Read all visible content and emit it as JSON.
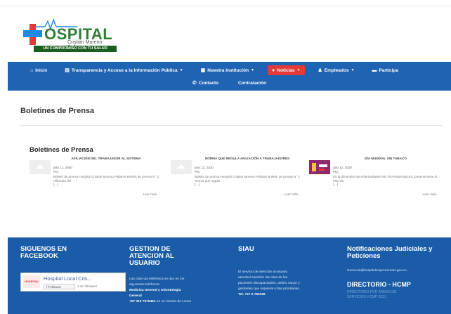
{
  "logo": {
    "brand": "OSPITAL",
    "subtitle": "Cristián Moreno Pallares",
    "tagline": "UN COMPROMISO CON TU SALUD"
  },
  "nav": {
    "row1": [
      {
        "label": "Inicio",
        "icon": "home-icon",
        "glyph": "⌂",
        "caret": false,
        "active": false
      },
      {
        "label": "Transparencia y Acceso a la Información Pública",
        "icon": "document-icon",
        "glyph": "▤",
        "caret": true,
        "active": false
      },
      {
        "label": "Nuestra Institución",
        "icon": "building-icon",
        "glyph": "▦",
        "caret": true,
        "active": false
      },
      {
        "label": "Noticias",
        "icon": "alert-icon",
        "glyph": "●",
        "caret": true,
        "active": true
      },
      {
        "label": "Empleados",
        "icon": "users-icon",
        "glyph": "♟",
        "caret": true,
        "active": false
      },
      {
        "label": "Participa",
        "icon": "id-card-icon",
        "glyph": "▬",
        "caret": false,
        "active": false
      }
    ],
    "row2": [
      {
        "label": "Contacto",
        "icon": "phone-icon",
        "glyph": "✆"
      },
      {
        "label": "Contratación",
        "icon": "",
        "glyph": ""
      }
    ]
  },
  "page": {
    "title": "Boletines de Prensa",
    "section_title": "Boletines de Prensa"
  },
  "posts": [
    {
      "title": "AFILIACIÓN DEL TRABAJADOR AL SISTEMA",
      "date": "julio 12, 2020",
      "category": "PIC",
      "excerpt": "Boletín de prensa Hospital Cristian Moreno Pallares Boletín de prensa N° 3 Afiliación del",
      "ellipsis": "[…]",
      "more": "Leer más...",
      "thumb": "placeholder"
    },
    {
      "title": "NORMA QUE REGULA AFILIACIÓN A TRABAJADORES",
      "date": "julio 12, 2020",
      "category": "PIC",
      "excerpt": "Boletín de prensa Hospital Cristian Moreno Pallares Boletín de prensa N° 2 Norma que regula",
      "ellipsis": "[…]",
      "more": "Leer más...",
      "thumb": "placeholder"
    },
    {
      "title": "DÍA MUNDIAL SIN TABACO",
      "date": "julio 12, 2020",
      "category": "PIC",
      "excerpt": "En la dimensión de enfermedades NO TRANSMISIBLES, perteneciente al Plan de",
      "ellipsis": "[…]",
      "more": "Leer más...",
      "thumb": "image"
    }
  ],
  "footer": {
    "facebook": {
      "heading": "SIGUENOS EN FACEBOOK",
      "page_name": "Hospital Local Cris...",
      "logo_text": "HOSPITAL",
      "follow_button": "f  Followed",
      "followers": "2.4K followers"
    },
    "gestion": {
      "heading": "GESTION DE ATENCION AL USUARIO",
      "line1": "Las citas vía telefónica se dan en los",
      "line2": "siguientes teléfonos:",
      "line3": "Medicina General y Odontología",
      "line4": "General",
      "line5_bold": "+57 310 7575451",
      "line5_rest": " en un horario de Lunes"
    },
    "siau": {
      "heading": "SIAU",
      "line1": "El servicio de atención al usuario",
      "line2": "atenderá también las citas de los",
      "line3": "pacientes discapacitados, adulto mayor y",
      "line4": "gestantes que requieran citas prioritarias.",
      "line5": "Tel. +57 5 760336"
    },
    "notificaciones": {
      "heading": "Notificaciones Judiciales y Peticiones",
      "email": "Gerencia@hospitalcmpcurumani.gov.co",
      "directory_link": "DIRECTORIO - HCMP",
      "directory_sub1": "DIRECTORIO POR ÁREAS DE",
      "directory_sub2": "SERVICIOS HCMP 2021"
    }
  },
  "colors": {
    "nav_bg": "#1f63b3",
    "nav_active": "#e53935",
    "footer_bg": "#1a5ca7",
    "brand_green": "#2e7d32"
  }
}
